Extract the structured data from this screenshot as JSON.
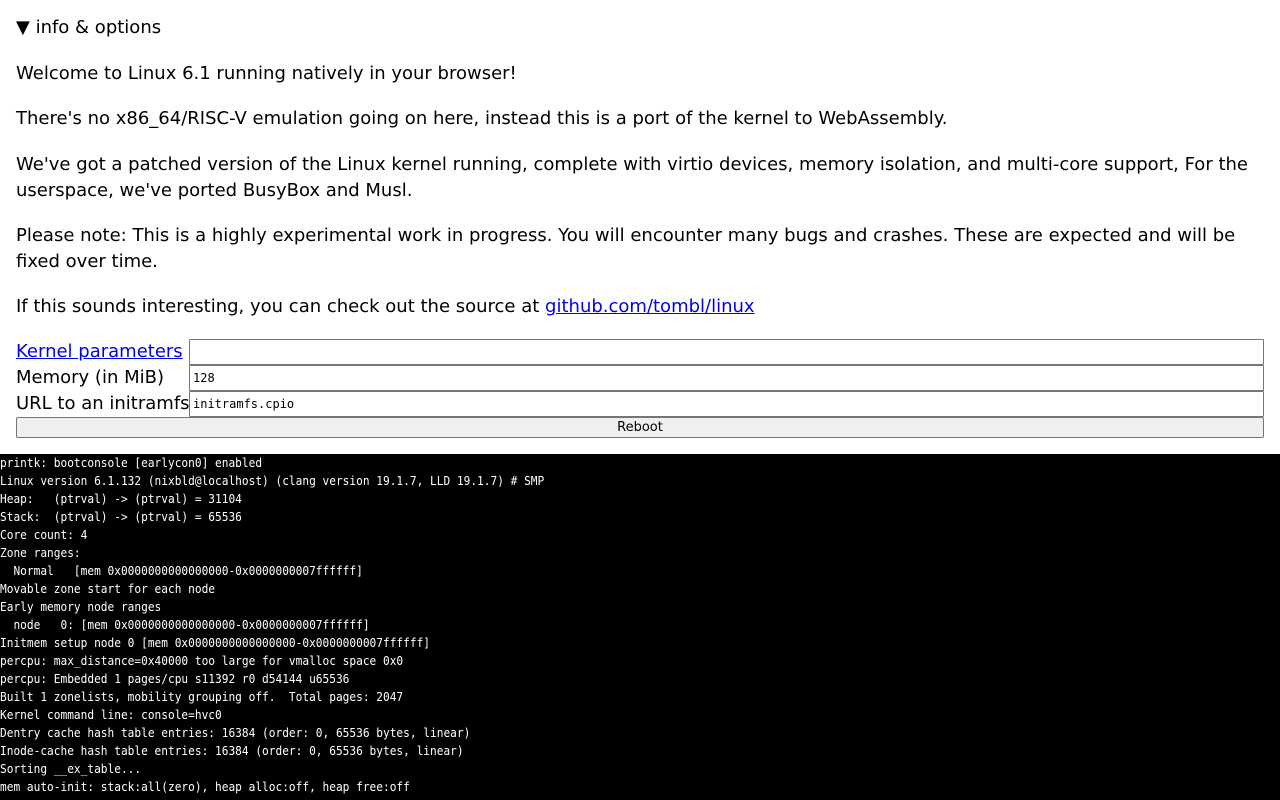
{
  "info": {
    "summary": "▼ info & options",
    "welcome": "Welcome to Linux 6.1 running natively in your browser!",
    "no_emulation": "There's no x86_64/RISC-V emulation going on here, instead this is a port of the kernel to WebAssembly.",
    "patched": "We've got a patched version of the Linux kernel running, complete with virtio devices, memory isolation, and multi-core support, For the userspace, we've ported BusyBox and Musl.",
    "note": "Please note: This is a highly experimental work in progress. You will encounter many bugs and crashes. These are expected and will be fixed over time.",
    "source_prefix": "If this sounds interesting, you can check out the source at ",
    "source_link": "github.com/tombl/linux"
  },
  "options": {
    "kernel_params_label": "Kernel parameters",
    "kernel_params_value": "",
    "memory_label": "Memory (in MiB)",
    "memory_value": "128",
    "initramfs_label": "URL to an initramfs",
    "initramfs_value": "initramfs.cpio",
    "reboot_label": "Reboot"
  },
  "terminal": {
    "lines": [
      "printk: bootconsole [earlycon0] enabled",
      "Linux version 6.1.132 (nixbld@localhost) (clang version 19.1.7, LLD 19.1.7) # SMP",
      "Heap:   (ptrval) -> (ptrval) = 31104",
      "Stack:  (ptrval) -> (ptrval) = 65536",
      "Core count: 4",
      "Zone ranges:",
      "  Normal   [mem 0x0000000000000000-0x0000000007ffffff]",
      "Movable zone start for each node",
      "Early memory node ranges",
      "  node   0: [mem 0x0000000000000000-0x0000000007ffffff]",
      "Initmem setup node 0 [mem 0x0000000000000000-0x0000000007ffffff]",
      "percpu: max_distance=0x40000 too large for vmalloc space 0x0",
      "percpu: Embedded 1 pages/cpu s11392 r0 d54144 u65536",
      "Built 1 zonelists, mobility grouping off.  Total pages: 2047",
      "Kernel command line: console=hvc0",
      "Dentry cache hash table entries: 16384 (order: 0, 65536 bytes, linear)",
      "Inode-cache hash table entries: 16384 (order: 0, 65536 bytes, linear)",
      "Sorting __ex_table...",
      "mem auto-init: stack:all(zero), heap alloc:off, heap free:off"
    ]
  }
}
